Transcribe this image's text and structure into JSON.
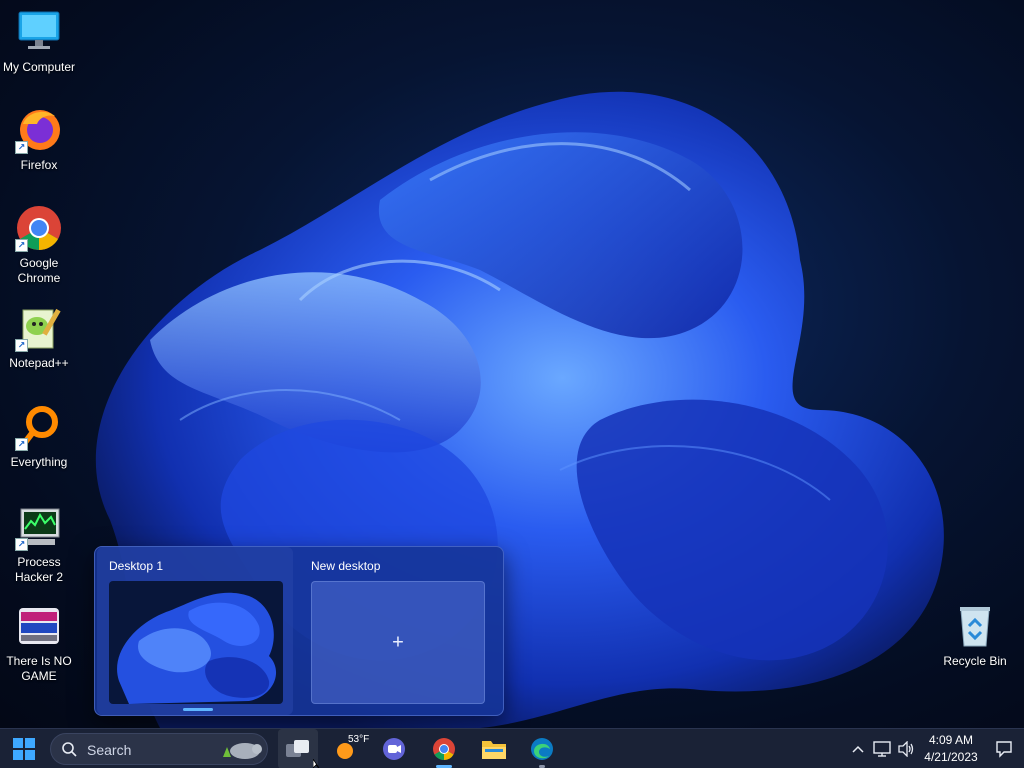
{
  "desktop": {
    "icons": [
      {
        "label": "My Computer"
      },
      {
        "label": "Firefox"
      },
      {
        "label": "Google\nChrome"
      },
      {
        "label": "Notepad++"
      },
      {
        "label": "Everything"
      },
      {
        "label": "Process\nHacker 2"
      },
      {
        "label": "There Is NO\nGAME"
      },
      {
        "label": "Recycle Bin"
      }
    ]
  },
  "task_view": {
    "desktops": [
      {
        "title": "Desktop 1",
        "active": true
      },
      {
        "title": "New desktop",
        "add_symbol": "+"
      }
    ]
  },
  "taskbar": {
    "search_label": "Search",
    "weather_temp": "53°F",
    "clock_time": "4:09 AM",
    "clock_date": "4/21/2023",
    "apps": [
      "start-icon",
      "task-view-icon",
      "weather-icon",
      "teams-chat-icon",
      "chrome-icon",
      "file-explorer-icon",
      "edge-icon"
    ],
    "tray": [
      "show-hidden-icons-chevron",
      "network-icon",
      "volume-icon",
      "notification-icon"
    ]
  },
  "colors": {
    "taskbar_bg": "#1a2236",
    "accent": "#5fb6ff",
    "taskview_bg": "#16349a"
  }
}
